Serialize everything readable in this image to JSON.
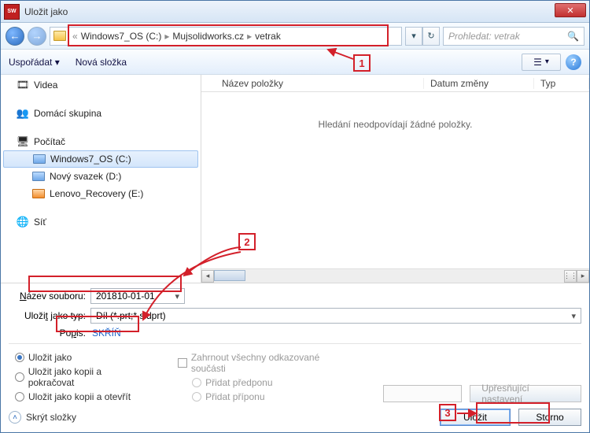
{
  "window": {
    "title": "Uložit jako"
  },
  "nav": {
    "crumbs": [
      "Windows7_OS (C:)",
      "Mujsolidworks.cz",
      "vetrak"
    ],
    "search_placeholder": "Prohledat: vetrak"
  },
  "toolbar": {
    "organize": "Uspořádat",
    "new_folder": "Nová složka"
  },
  "sidebar": {
    "items": [
      {
        "label": "Videa",
        "icon": "📽"
      },
      {
        "label": "Domácí skupina",
        "icon": "👥"
      },
      {
        "label": "Počítač",
        "icon": "🖥"
      }
    ],
    "drives": [
      "Windows7_OS (C:)",
      "Nový svazek (D:)",
      "Lenovo_Recovery (E:)"
    ],
    "network": "Síť"
  },
  "list": {
    "cols": {
      "name": "Název položky",
      "date": "Datum změny",
      "type": "Typ"
    },
    "empty": "Hledání neodpovídají žádné položky."
  },
  "form": {
    "filename_label_pre": "N",
    "filename_label_rest": "ázev souboru:",
    "filename_value": "201810-01-01",
    "filetype_label_pre": "Uloži",
    "filetype_label_u": "t",
    "filetype_label_post": " jako typ:",
    "filetype_value": "Díl (*.prt;*.sldprt)",
    "popis_label_pre": "Po",
    "popis_label_u": "p",
    "popis_label_post": "is:",
    "popis_value": "SKŘÍŇ"
  },
  "options": {
    "save_as": "Uložit jako",
    "save_copy_continue": "Uložit jako kopii a pokračovat",
    "save_copy_open": "Uložit jako kopii a otevřít",
    "include_refs": "Zahrnout všechny odkazované součásti",
    "add_prefix": "Přidat předponu",
    "add_suffix": "Přidat příponu",
    "advanced_settings": "Upřesňující nastavení",
    "hide_folders": "Skrýt složky"
  },
  "buttons": {
    "save": "Uložit",
    "cancel": "Storno"
  },
  "annotations": {
    "a1": "1",
    "a2": "2",
    "a3": "3"
  }
}
